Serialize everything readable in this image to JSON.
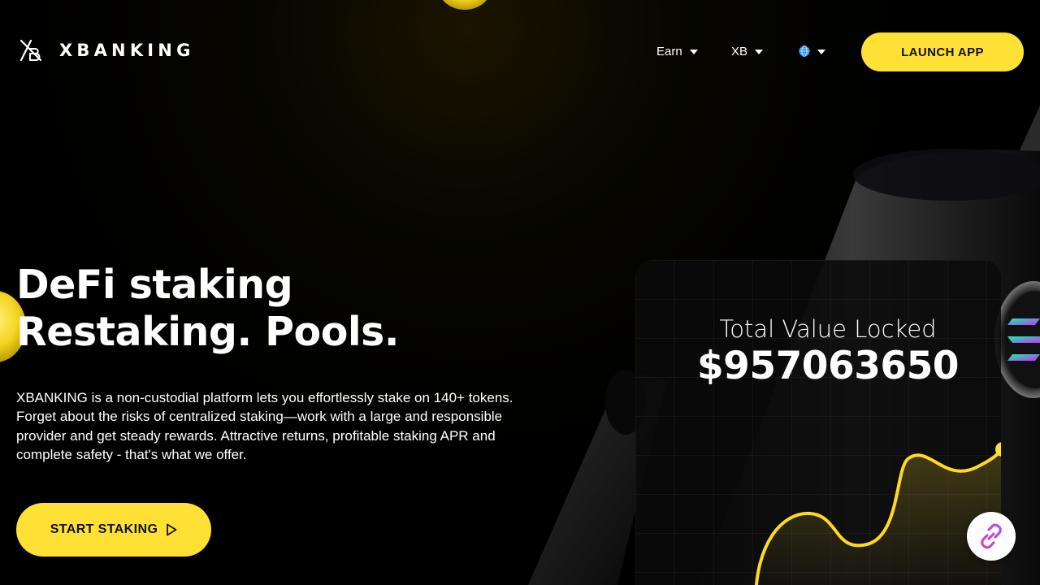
{
  "header": {
    "logo_text": "XBANKING",
    "nav": [
      {
        "label": "Earn"
      },
      {
        "label": "XB"
      }
    ],
    "language_icon": "globe-icon",
    "launch_button": "LAUNCH APP"
  },
  "hero": {
    "title_line1": "DeFi staking",
    "title_line2": "Restaking. Pools.",
    "description_lines": [
      "XBANKING is a non-custodial platform lets you effortlessly stake on 140+ tokens.",
      "Forget about the risks of centralized staking—work with a large and  responsible",
      "provider and get steady rewards.  Attractive returns, profitable staking APR and",
      "complete safety - that's what we offer."
    ],
    "cta_button": "START STAKING",
    "cta_icon": "play-icon"
  },
  "tvl": {
    "label": "Total Value Locked",
    "value": "$957063650"
  },
  "floating_button_icon": "link-icon",
  "colors": {
    "accent": "#ffe135",
    "background": "#000000",
    "text": "#ffffff"
  }
}
